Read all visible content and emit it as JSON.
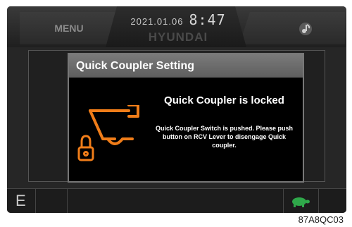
{
  "header": {
    "menu_label": "MENU",
    "date": "2021.01.06",
    "time": "8:47",
    "brand": "HYUNDAI",
    "right_icon": "music-icon"
  },
  "bottom": {
    "mode_label": "E",
    "status_icon": "turtle-icon"
  },
  "dialog": {
    "title": "Quick Coupler Setting",
    "heading": "Quick Coupler is locked",
    "message": "Quick Coupler Switch is pushed. Please push button on RCV Lever to disengage Quick coupler.",
    "icon": "quick-coupler-lock-icon"
  },
  "caption": "87A8QC03",
  "colors": {
    "accent_orange": "#f07d19",
    "turtle_green": "#2fa84a"
  }
}
